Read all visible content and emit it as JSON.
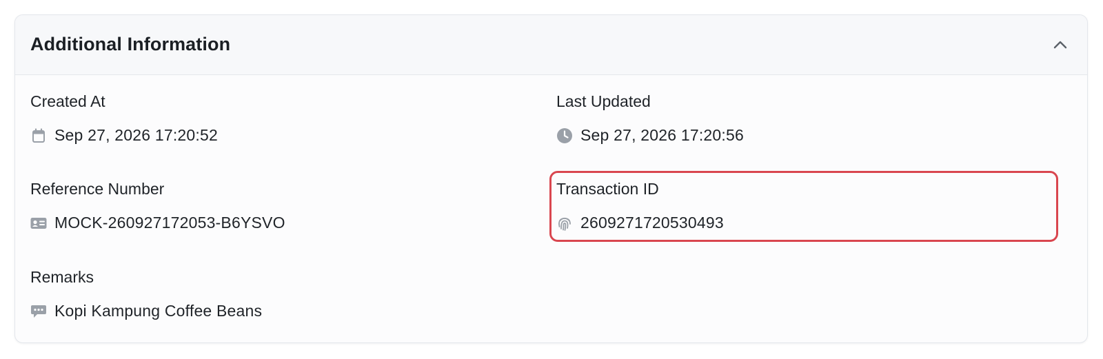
{
  "section": {
    "title": "Additional Information",
    "collapse_icon": "chevron-up-icon"
  },
  "fields": {
    "created_at": {
      "label": "Created At",
      "value": "Sep 27, 2026 17:20:52",
      "icon": "calendar-icon"
    },
    "last_updated": {
      "label": "Last Updated",
      "value": "Sep 27, 2026 17:20:56",
      "icon": "clock-icon"
    },
    "reference_number": {
      "label": "Reference Number",
      "value": "MOCK-260927172053-B6YSVO",
      "icon": "id-card-icon"
    },
    "transaction_id": {
      "label": "Transaction ID",
      "value": "2609271720530493",
      "icon": "fingerprint-icon"
    },
    "remarks": {
      "label": "Remarks",
      "value": "Kopi Kampung Coffee Beans",
      "icon": "comment-icon"
    }
  },
  "colors": {
    "highlight_border": "#d9464f",
    "icon_gray": "#9aa0a8"
  }
}
